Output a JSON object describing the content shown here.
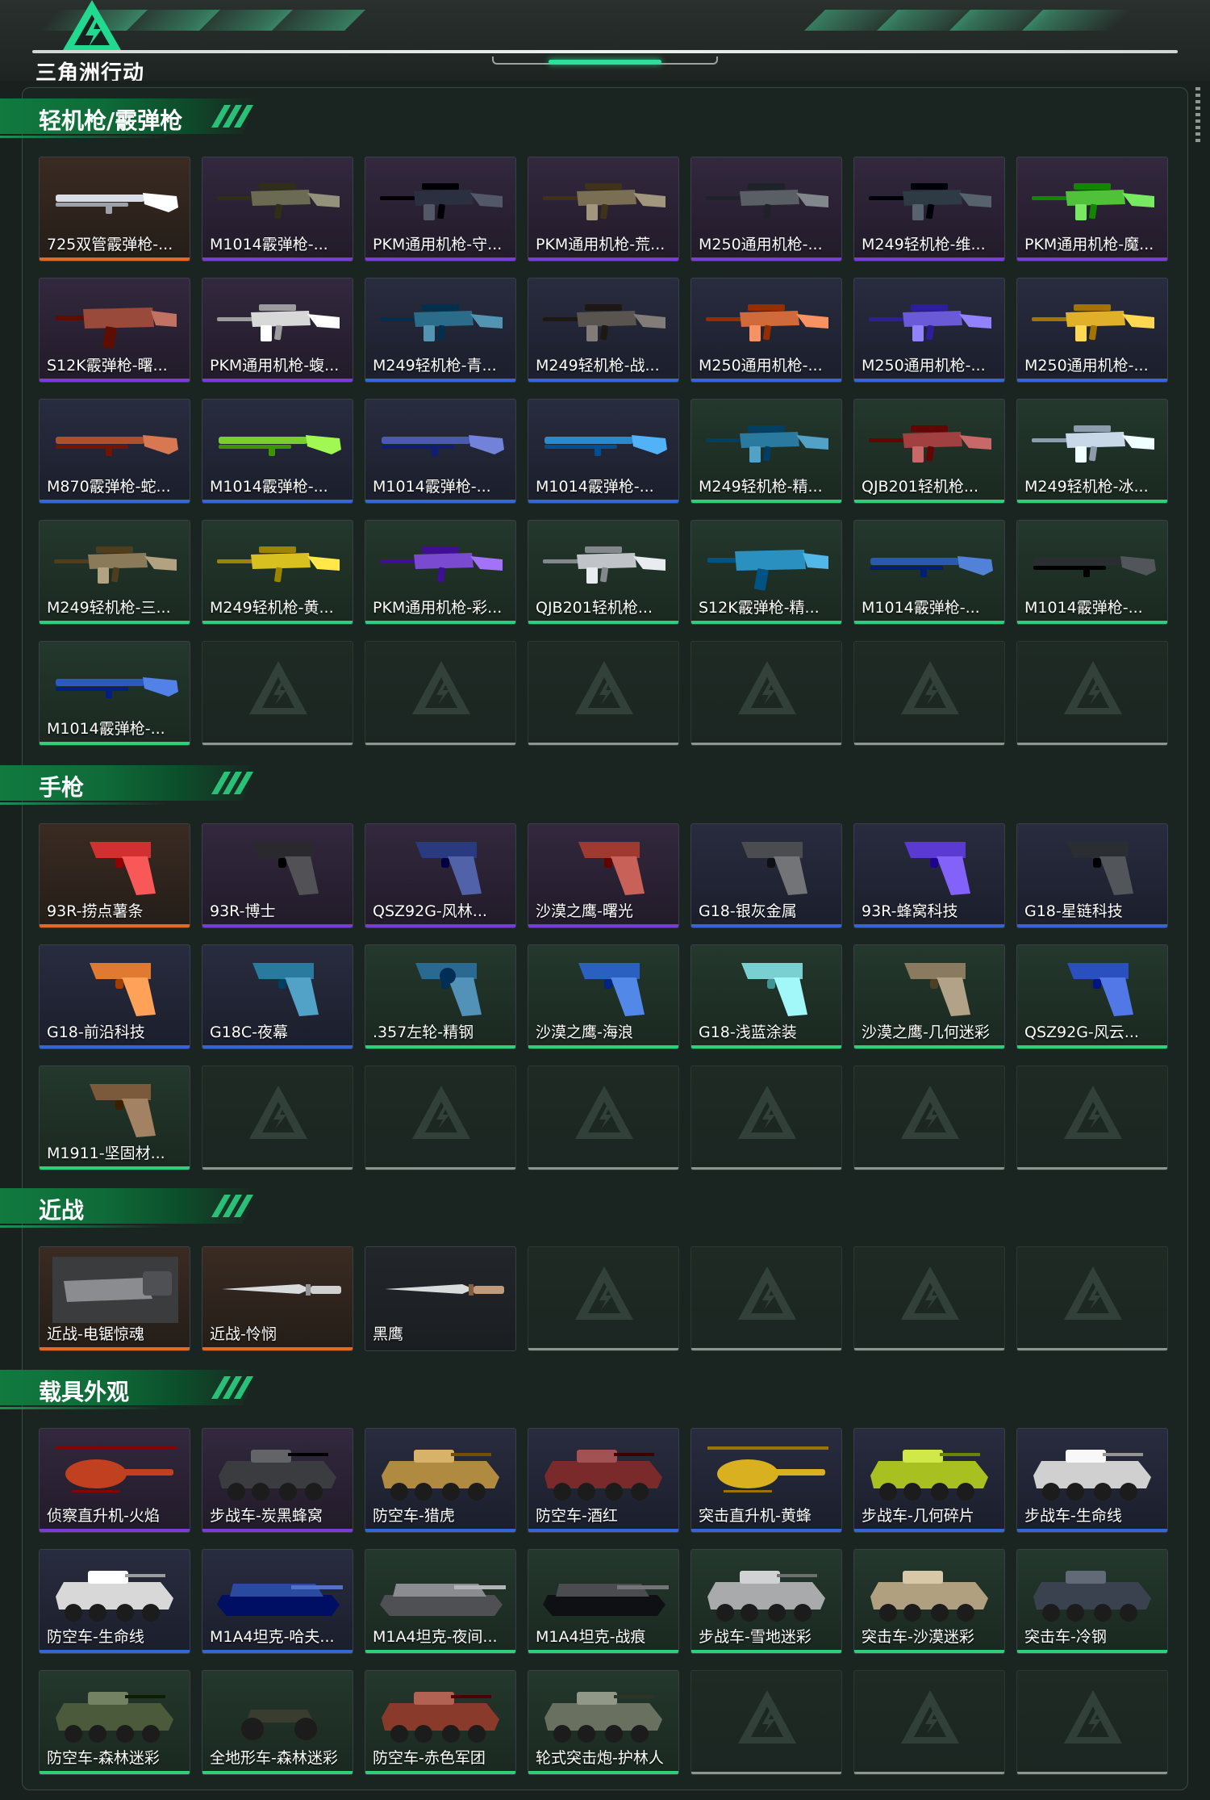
{
  "app": {
    "logo_text": "三角洲行动"
  },
  "sections": [
    {
      "title": "轻机枪/霰弹枪",
      "items": [
        {
          "label": "725双管霰弹枪-...",
          "rarity": "orange",
          "kind": "shotgun",
          "color": "#d8dde6"
        },
        {
          "label": "M1014霰弹枪-...",
          "rarity": "purple",
          "kind": "rifle",
          "color": "#6b6a52"
        },
        {
          "label": "PKM通用机枪-守...",
          "rarity": "purple",
          "kind": "lmg",
          "color": "#2a3040"
        },
        {
          "label": "PKM通用机枪-荒...",
          "rarity": "purple",
          "kind": "lmg",
          "color": "#7a6f55"
        },
        {
          "label": "M250通用机枪-...",
          "rarity": "purple",
          "kind": "rifle",
          "color": "#5a5f66"
        },
        {
          "label": "M249轻机枪-维...",
          "rarity": "purple",
          "kind": "lmg",
          "color": "#2e3a44"
        },
        {
          "label": "PKM通用机枪-魔...",
          "rarity": "purple",
          "kind": "lmg",
          "color": "#4fc23a"
        },
        {
          "label": "S12K霰弹枪-曙...",
          "rarity": "purple",
          "kind": "smg",
          "color": "#9a4a3a"
        },
        {
          "label": "PKM通用机枪-蝮...",
          "rarity": "purple",
          "kind": "lmg",
          "color": "#d8d8d8"
        },
        {
          "label": "M249轻机枪-青...",
          "rarity": "blue",
          "kind": "lmg",
          "color": "#2a6c8a"
        },
        {
          "label": "M249轻机枪-战...",
          "rarity": "blue",
          "kind": "lmg",
          "color": "#5a5450"
        },
        {
          "label": "M250通用机枪-...",
          "rarity": "blue",
          "kind": "lmg",
          "color": "#d06a3a"
        },
        {
          "label": "M250通用机枪-...",
          "rarity": "blue",
          "kind": "lmg",
          "color": "#6a5ad8"
        },
        {
          "label": "M250通用机枪-...",
          "rarity": "blue",
          "kind": "lmg",
          "color": "#e0b02a"
        },
        {
          "label": "M870霰弹枪-蛇...",
          "rarity": "blue",
          "kind": "shotgun",
          "color": "#b0502a"
        },
        {
          "label": "M1014霰弹枪-...",
          "rarity": "blue",
          "kind": "shotgun",
          "color": "#7ad02a"
        },
        {
          "label": "M1014霰弹枪-...",
          "rarity": "blue",
          "kind": "shotgun",
          "color": "#4a5ab0"
        },
        {
          "label": "M1014霰弹枪-...",
          "rarity": "blue",
          "kind": "shotgun",
          "color": "#2a8ad0"
        },
        {
          "label": "M249轻机枪-精...",
          "rarity": "green",
          "kind": "lmg",
          "color": "#2a7aa0"
        },
        {
          "label": "QJB201轻机枪...",
          "rarity": "green",
          "kind": "lmg",
          "color": "#a04040"
        },
        {
          "label": "M249轻机枪-冰...",
          "rarity": "green",
          "kind": "lmg",
          "color": "#c8d8e8"
        },
        {
          "label": "M249轻机枪-三...",
          "rarity": "green",
          "kind": "lmg",
          "color": "#8a7a5a"
        },
        {
          "label": "M249轻机枪-黄...",
          "rarity": "green",
          "kind": "rifle",
          "color": "#d8c020"
        },
        {
          "label": "PKM通用机枪-彩...",
          "rarity": "green",
          "kind": "rifle",
          "color": "#7a4ad0"
        },
        {
          "label": "QJB201轻机枪...",
          "rarity": "green",
          "kind": "lmg",
          "color": "#c0c4c8"
        },
        {
          "label": "S12K霰弹枪-精...",
          "rarity": "green",
          "kind": "smg",
          "color": "#2a90c0"
        },
        {
          "label": "M1014霰弹枪-...",
          "rarity": "green",
          "kind": "shotgun",
          "color": "#2a5ab0"
        },
        {
          "label": "M1014霰弹枪-...",
          "rarity": "green",
          "kind": "shotgun",
          "color": "#2a2e33"
        },
        {
          "label": "M1014霰弹枪-...",
          "rarity": "green",
          "kind": "shotgun",
          "color": "#2a5ac0"
        }
      ],
      "empty_slots": 6
    },
    {
      "title": "手枪",
      "items": [
        {
          "label": "93R-捞点薯条",
          "rarity": "orange",
          "kind": "pistol",
          "color": "#d03030"
        },
        {
          "label": "93R-博士",
          "rarity": "purple",
          "kind": "pistol",
          "color": "#2a2a2e"
        },
        {
          "label": "QSZ92G-风林...",
          "rarity": "purple",
          "kind": "pistol",
          "color": "#2a3a80"
        },
        {
          "label": "沙漠之鹰-曙光",
          "rarity": "purple",
          "kind": "pistol",
          "color": "#a03a30"
        },
        {
          "label": "G18-银灰金属",
          "rarity": "blue",
          "kind": "pistol",
          "color": "#4a4c50"
        },
        {
          "label": "93R-蜂窝科技",
          "rarity": "blue",
          "kind": "pistol",
          "color": "#5a3ad0"
        },
        {
          "label": "G18-星链科技",
          "rarity": "blue",
          "kind": "pistol",
          "color": "#2a2e33"
        },
        {
          "label": "G18-前沿科技",
          "rarity": "blue",
          "kind": "pistol",
          "color": "#e07a30"
        },
        {
          "label": "G18C-夜幕",
          "rarity": "blue",
          "kind": "pistol",
          "color": "#2a7aa0"
        },
        {
          "label": ".357左轮-精钢",
          "rarity": "green",
          "kind": "revolver",
          "color": "#2a6a90"
        },
        {
          "label": "沙漠之鹰-海浪",
          "rarity": "green",
          "kind": "pistol",
          "color": "#2a60c0"
        },
        {
          "label": "G18-浅蓝涂装",
          "rarity": "green",
          "kind": "pistol",
          "color": "#7ad0d0"
        },
        {
          "label": "沙漠之鹰-几何迷彩",
          "rarity": "green",
          "kind": "pistol",
          "color": "#8a7a60"
        },
        {
          "label": "QSZ92G-风云...",
          "rarity": "green",
          "kind": "pistol",
          "color": "#2a50c0"
        },
        {
          "label": "M1911-坚固材...",
          "rarity": "green",
          "kind": "pistol",
          "color": "#7a5a3a"
        }
      ],
      "empty_slots": 6
    },
    {
      "title": "近战",
      "items": [
        {
          "label": "近战-电锯惊魂",
          "rarity": "orange",
          "kind": "saw",
          "color": "#8a8c90"
        },
        {
          "label": "近战-怜悯",
          "rarity": "orange",
          "kind": "knife",
          "color": "#d0d0d0"
        },
        {
          "label": "黑鹰",
          "rarity": "none",
          "kind": "knife",
          "color": "#c09a7a"
        }
      ],
      "empty_slots": 4
    },
    {
      "title": "载具外观",
      "items": [
        {
          "label": "侦察直升机-火焰",
          "rarity": "purple",
          "kind": "heli",
          "color": "#c04020"
        },
        {
          "label": "步战车-炭黑蜂窝",
          "rarity": "purple",
          "kind": "apc",
          "color": "#3a3c40"
        },
        {
          "label": "防空车-猎虎",
          "rarity": "blue",
          "kind": "apc",
          "color": "#b08a40"
        },
        {
          "label": "防空车-酒红",
          "rarity": "blue",
          "kind": "apc",
          "color": "#7a2a2a"
        },
        {
          "label": "突击直升机-黄蜂",
          "rarity": "blue",
          "kind": "heli",
          "color": "#d8b020"
        },
        {
          "label": "步战车-几何碎片",
          "rarity": "blue",
          "kind": "apc",
          "color": "#a8c020"
        },
        {
          "label": "步战车-生命线",
          "rarity": "blue",
          "kind": "apc",
          "color": "#d0d0d0"
        },
        {
          "label": "防空车-生命线",
          "rarity": "blue",
          "kind": "apc",
          "color": "#d8d8d8"
        },
        {
          "label": "M1A4坦克-哈夫...",
          "rarity": "blue",
          "kind": "tank",
          "color": "#2a4aa0"
        },
        {
          "label": "M1A4坦克-夜间...",
          "rarity": "green",
          "kind": "tank",
          "color": "#8a8c90"
        },
        {
          "label": "M1A4坦克-战痕",
          "rarity": "green",
          "kind": "tank",
          "color": "#4a4c50"
        },
        {
          "label": "步战车-雪地迷彩",
          "rarity": "green",
          "kind": "apc",
          "color": "#a8aaac"
        },
        {
          "label": "突击车-沙漠迷彩",
          "rarity": "green",
          "kind": "jeep",
          "color": "#b0a080"
        },
        {
          "label": "突击车-冷钢",
          "rarity": "green",
          "kind": "jeep",
          "color": "#3a4250"
        },
        {
          "label": "防空车-森林迷彩",
          "rarity": "green",
          "kind": "apc",
          "color": "#4a5a3a"
        },
        {
          "label": "全地形车-森林迷彩",
          "rarity": "green",
          "kind": "atv",
          "color": "#3a3c30"
        },
        {
          "label": "防空车-赤色军团",
          "rarity": "green",
          "kind": "apc",
          "color": "#8a3a2a"
        },
        {
          "label": "轮式突击炮-护林人",
          "rarity": "green",
          "kind": "apc",
          "color": "#6a7060"
        }
      ],
      "empty_slots": 3
    }
  ]
}
